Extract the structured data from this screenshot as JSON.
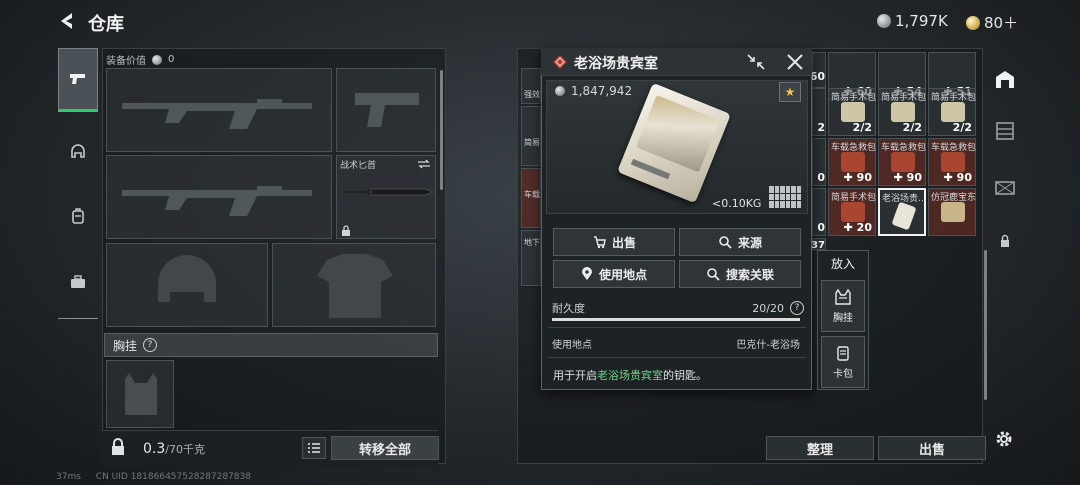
{
  "header": {
    "title": "仓库",
    "coins": "1,797K",
    "premium": "80＋"
  },
  "equipment": {
    "value_label": "装备价值",
    "value": "0",
    "knife_label": "战术匕首",
    "chest_label": "胸挂",
    "chest_help": "?",
    "weight_value": "0.3",
    "weight_max": "/70千克",
    "transfer_all": "转移全部"
  },
  "stash": {
    "cells": [
      {
        "label": "强效",
        "count": ""
      },
      {
        "label": "",
        "count": "60"
      },
      {
        "label": "",
        "count": "✚ 60"
      },
      {
        "label": "",
        "count": "✚ 54"
      },
      {
        "label": "",
        "count": "✚ 51"
      },
      {
        "label": "简易手术包",
        "count": "2/2"
      },
      {
        "label": "简易手术包",
        "count": "2/2"
      },
      {
        "label": "简易手术包",
        "count": "2/2"
      },
      {
        "label": "简易手术包",
        "count": "2/2"
      },
      {
        "label": "车载急救包",
        "count": "✚ 90"
      },
      {
        "label": "车载急救包",
        "count": "✚ 90"
      },
      {
        "label": "车载急救包",
        "count": "✚ 90"
      },
      {
        "label": "车载急救包",
        "count": "✚ 20"
      },
      {
        "label": "老浴场贵…",
        "count": ""
      },
      {
        "label": "仿冠鹿宝东",
        "count": ""
      },
      {
        "label": "地下",
        "count": ""
      },
      {
        "label": "",
        "count": "37"
      }
    ],
    "sort_button": "整理",
    "sell_button": "出售"
  },
  "popup": {
    "title": "老浴场贵宾室",
    "value": "1,847,942",
    "weight": "<0.10KG",
    "buttons": {
      "sell": "出售",
      "source": "来源",
      "use_location": "使用地点",
      "search_related": "搜索关联"
    },
    "durability_label": "耐久度",
    "durability_value": "20/20",
    "location_label": "使用地点",
    "location_value": "巴克什-老浴场",
    "desc_prefix": "用于开启",
    "desc_highlight": "老浴场贵宾室",
    "desc_suffix": "的钥匙。"
  },
  "putin": {
    "title": "放入",
    "chest": "胸挂",
    "card": "卡包"
  },
  "footer": {
    "ping": "37ms",
    "uid": "CN UID 181866457528287287838"
  },
  "colors": {
    "accent_green": "#2ecc71",
    "highlight_green": "#6fd38a",
    "medical_red": "#a84632"
  }
}
